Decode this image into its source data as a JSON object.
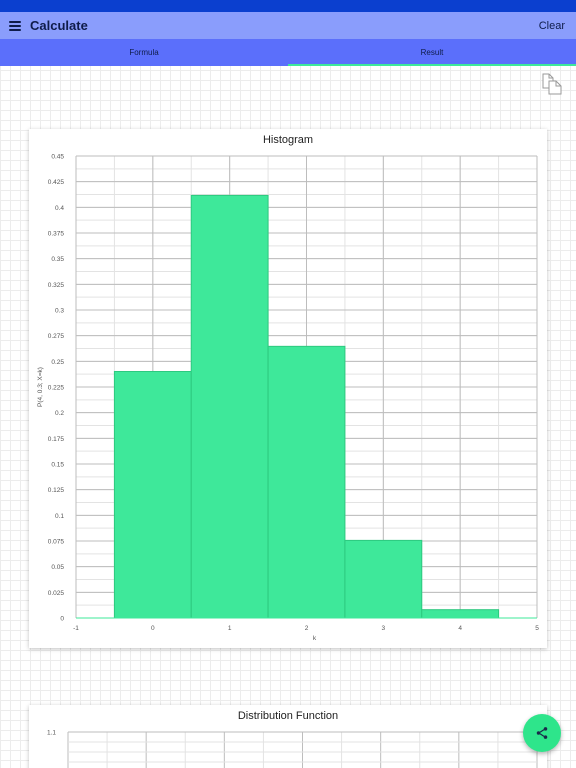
{
  "app_bar": {
    "title": "Calculate",
    "clear_label": "Clear"
  },
  "tabs": [
    {
      "label": "Formula"
    },
    {
      "label": "Result"
    }
  ],
  "icons": {
    "menu": "menu-icon",
    "copy": "copy-icon",
    "share": "share-icon"
  },
  "colors": {
    "status_bar": "#0b3fcf",
    "app_bar": "#8a9dfc",
    "tab_bar": "#5b6ffb",
    "accent": "#3ee89a",
    "bar_fill": "#3ee89a"
  },
  "chart_data": [
    {
      "type": "bar",
      "title": "Histogram",
      "xlabel": "k",
      "ylabel": "P(4, 0.3; X=k)",
      "categories": [
        0,
        1,
        2,
        3,
        4
      ],
      "values": [
        0.2401,
        0.4116,
        0.2646,
        0.0756,
        0.0081
      ],
      "xlim": [
        -1,
        5
      ],
      "ylim": [
        0,
        0.45
      ],
      "x_ticks": [
        "-1",
        "0",
        "1",
        "2",
        "3",
        "4",
        "5"
      ],
      "y_ticks": [
        "0",
        "0.025",
        "0.05",
        "0.075",
        "0.1",
        "0.125",
        "0.15",
        "0.175",
        "0.2",
        "0.225",
        "0.25",
        "0.275",
        "0.3",
        "0.325",
        "0.35",
        "0.375",
        "0.4",
        "0.425",
        "0.45"
      ],
      "grid": true
    },
    {
      "type": "line",
      "title": "Distribution Function",
      "y_ticks": [
        "1.1"
      ],
      "grid": true
    }
  ]
}
